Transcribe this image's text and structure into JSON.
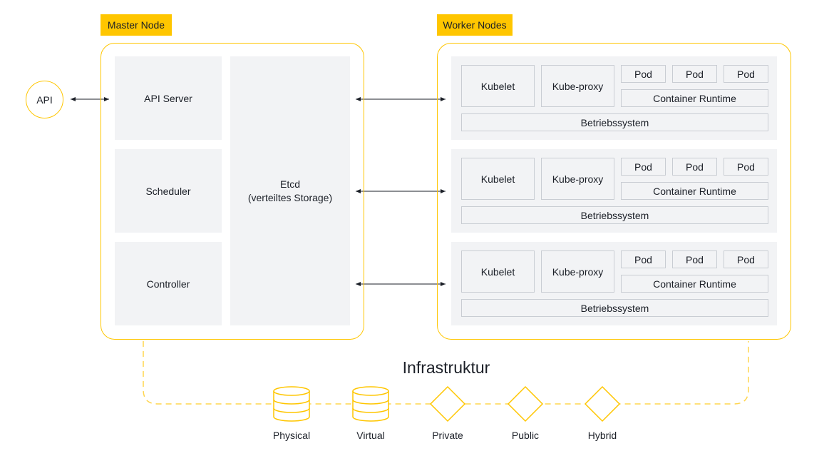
{
  "colors": {
    "accent": "#FFC600",
    "box": "#F2F3F5",
    "text": "#1b1f27"
  },
  "api": {
    "label": "API"
  },
  "master": {
    "title": "Master Node",
    "components": [
      "API Server",
      "Scheduler",
      "Controller"
    ],
    "etcd": {
      "line1": "Etcd",
      "line2": "(verteiltes Storage)"
    }
  },
  "workers": {
    "title": "Worker Nodes",
    "nodes": [
      {
        "kubelet": "Kubelet",
        "proxy": "Kube-proxy",
        "pods": [
          "Pod",
          "Pod",
          "Pod"
        ],
        "runtime": "Container Runtime",
        "os": "Betriebssystem"
      },
      {
        "kubelet": "Kubelet",
        "proxy": "Kube-proxy",
        "pods": [
          "Pod",
          "Pod",
          "Pod"
        ],
        "runtime": "Container Runtime",
        "os": "Betriebssystem"
      },
      {
        "kubelet": "Kubelet",
        "proxy": "Kube-proxy",
        "pods": [
          "Pod",
          "Pod",
          "Pod"
        ],
        "runtime": "Container Runtime",
        "os": "Betriebssystem"
      }
    ]
  },
  "infrastructure": {
    "title": "Infrastruktur",
    "items": [
      {
        "label": "Physical",
        "icon": "database-icon"
      },
      {
        "label": "Virtual",
        "icon": "database-icon"
      },
      {
        "label": "Private",
        "icon": "diamond-icon"
      },
      {
        "label": "Public",
        "icon": "diamond-icon"
      },
      {
        "label": "Hybrid",
        "icon": "diamond-icon"
      }
    ]
  }
}
